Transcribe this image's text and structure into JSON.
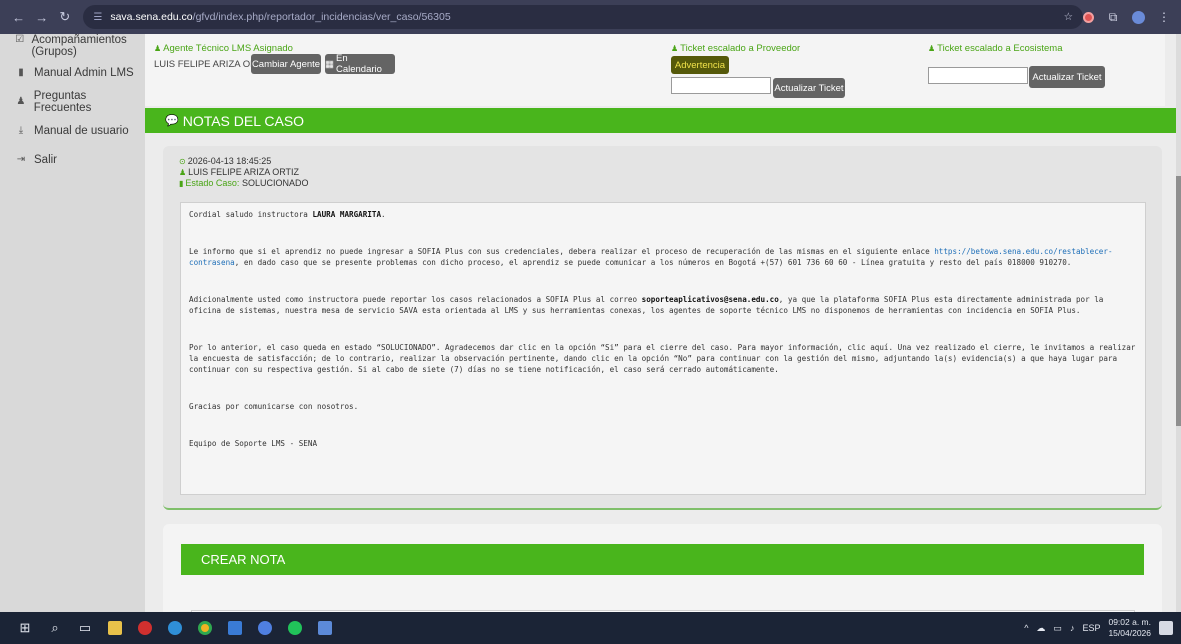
{
  "browser": {
    "url_domain": "sava.sena.edu.co",
    "url_path": "/gfvd/index.php/reportador_incidencias/ver_caso/56305"
  },
  "sidebar": {
    "items": [
      {
        "label": "Acompañamientos (Grupos)",
        "icon": "checkbox-icon"
      },
      {
        "label": "Manual Admin LMS",
        "icon": "book-icon"
      },
      {
        "label": "Preguntas Frecuentes",
        "icon": "group-icon"
      },
      {
        "label": "Manual de usuario",
        "icon": "download-icon"
      },
      {
        "label": "Salir",
        "icon": "sign-out-icon"
      }
    ]
  },
  "case_header": {
    "agent_label": "Agente Técnico LMS Asignado",
    "agent_name": "LUIS FELIPE ARIZA ORTIZ",
    "change_agent_button": "Cambiar Agente",
    "calendar_button": "En Calendario",
    "provider_label": "Ticket escalado a Proveedor",
    "warning_button": "Advertencia",
    "provider_ticket_value": "",
    "update_ticket_button_1": "Actualizar Ticket",
    "ecosystem_label": "Ticket escalado a Ecosistema",
    "ecosystem_ticket_value": "",
    "update_ticket_button_2": "Actualizar Ticket"
  },
  "notes_section": {
    "title": "NOTAS DEL CASO"
  },
  "note": {
    "datetime": "2026-04-13 18:45:25",
    "author": "LUIS FELIPE ARIZA ORTIZ",
    "status_label": "Estado Caso:",
    "status_value": "SOLUCIONADO",
    "greeting_prefix": "Cordial saludo instructora ",
    "greeting_name": "LAURA MARGARITA",
    "greeting_suffix": ".",
    "p1_text": "Le informo que si el aprendiz no puede ingresar a SOFIA Plus con sus credenciales, debera realizar el proceso de recuperación de las mismas en el siguiente enlace ",
    "p1_link": "https://betowa.sena.edu.co/restablecer-contrasena",
    "p1_rest": ", en dado caso que se presente problemas con dicho proceso, el aprendiz se puede comunicar a los números en Bogotá +(57) 601 736 60 60 - Línea gratuita y resto del país 018000 910270.",
    "p2_text": "Adicionalmente usted como instructora puede reportar los casos relacionados a SOFIA Plus al correo ",
    "p2_email": "soporteaplicativos@sena.edu.co",
    "p2_rest": ", ya que la plataforma SOFIA Plus esta directamente administrada por la oficina de sistemas, nuestra mesa de servicio SAVA esta orientada al LMS y sus herramientas conexas, los agentes de soporte técnico LMS no disponemos de herramientas con incidencia en SOFIA Plus.",
    "p3": "Por lo anterior, el caso queda en estado “SOLUCIONADO”. Agradecemos dar clic en la opción “Si” para el cierre del caso. Para mayor información, clic aquí. Una vez realizado el cierre, le invitamos a realizar la encuesta de satisfacción; de lo contrario, realizar la observación pertinente, dando clic en la opción “No” para continuar con la gestión del mismo, adjuntando la(s) evidencia(s) a que haya lugar para continuar con su respectiva gestión. Si al cabo de siete (7) días no se tiene notificación, el caso será cerrado automáticamente.",
    "p4": "Gracias por comunicarse con nosotros.",
    "p5": "Equipo de Soporte LMS - SENA"
  },
  "create_note": {
    "title": "CREAR NOTA"
  },
  "taskbar": {
    "language": "ESP",
    "time": "09:02 a. m.",
    "date": "15/04/2026"
  },
  "colors": {
    "accent_green": "#49b51c",
    "label_green": "#4aa516",
    "link_blue": "#1f6fb8"
  }
}
